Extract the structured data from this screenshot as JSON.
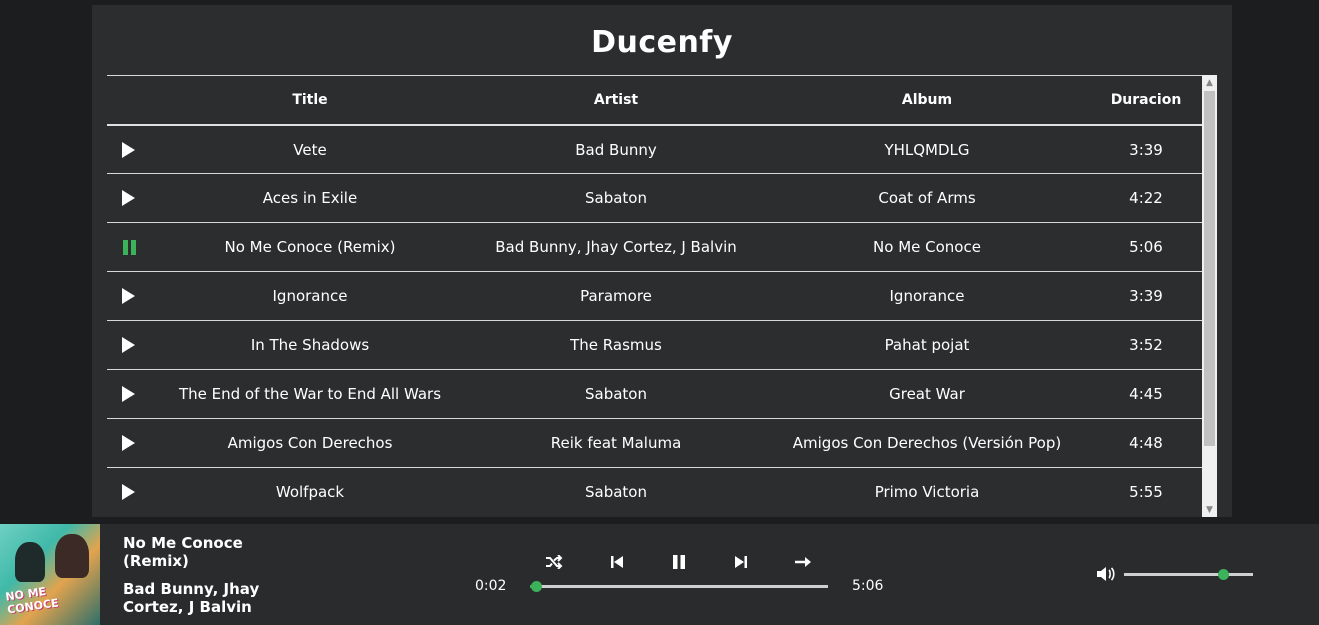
{
  "app": {
    "title": "Ducenfy"
  },
  "table": {
    "headers": {
      "title": "Title",
      "artist": "Artist",
      "album": "Album",
      "duration": "Duracion"
    },
    "rows": [
      {
        "title": "Vete",
        "artist": "Bad Bunny",
        "album": "YHLQMDLG",
        "duration": "3:39",
        "state": "play"
      },
      {
        "title": "Aces in Exile",
        "artist": "Sabaton",
        "album": "Coat of Arms",
        "duration": "4:22",
        "state": "play"
      },
      {
        "title": "No Me Conoce (Remix)",
        "artist": "Bad Bunny, Jhay Cortez, J Balvin",
        "album": "No Me Conoce",
        "duration": "5:06",
        "state": "pause"
      },
      {
        "title": "Ignorance",
        "artist": "Paramore",
        "album": "Ignorance",
        "duration": "3:39",
        "state": "play"
      },
      {
        "title": "In The Shadows",
        "artist": "The Rasmus",
        "album": "Pahat pojat",
        "duration": "3:52",
        "state": "play"
      },
      {
        "title": "The End of the War to End All Wars",
        "artist": "Sabaton",
        "album": "Great War",
        "duration": "4:45",
        "state": "play"
      },
      {
        "title": "Amigos Con Derechos",
        "artist": "Reik feat Maluma",
        "album": "Amigos Con Derechos (Versión Pop)",
        "duration": "4:48",
        "state": "play"
      },
      {
        "title": "Wolfpack",
        "artist": "Sabaton",
        "album": "Primo Victoria",
        "duration": "5:55",
        "state": "play"
      }
    ]
  },
  "player": {
    "title": "No Me Conoce (Remix)",
    "artist": "Bad Bunny, Jhay Cortez, J Balvin",
    "current_time": "0:02",
    "total_time": "5:06",
    "progress_fraction": 0.02,
    "volume_fraction": 0.77,
    "cover_text": "NO ME CONOCE",
    "controls": [
      "shuffle-icon",
      "previous-icon",
      "pause-icon",
      "next-icon",
      "repeat-icon"
    ]
  },
  "colors": {
    "accent": "#3cb35a",
    "panel": "#2c2d2f",
    "background": "#1c1d1e"
  }
}
